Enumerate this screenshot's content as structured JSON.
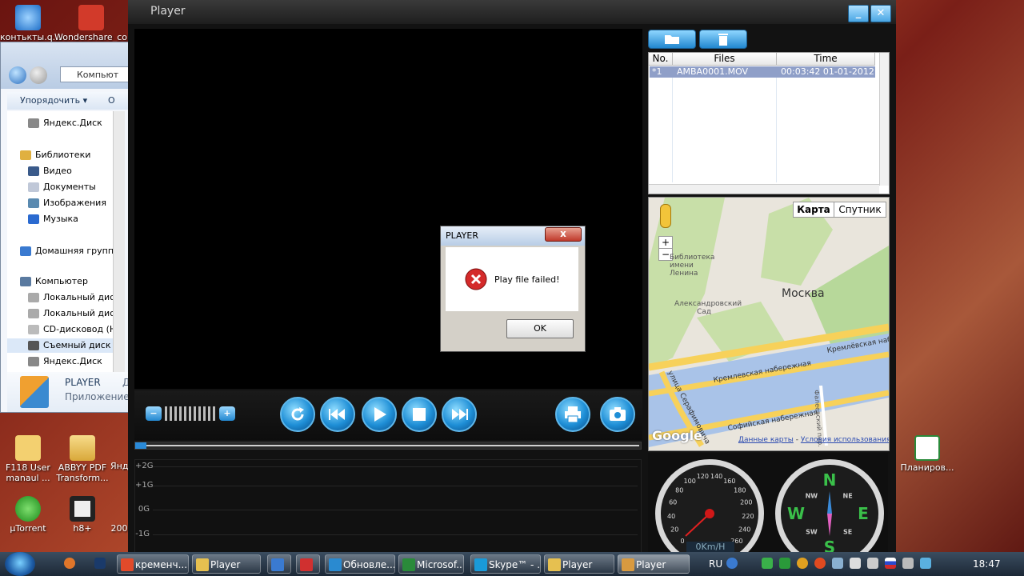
{
  "desktop": {
    "icons_top": [
      {
        "label": "контькты.q...",
        "color": "#3b8bd6"
      },
      {
        "label": "Wondershare_com",
        "color": "#d23a2a"
      }
    ],
    "icons_bottom": [
      {
        "label": "F118 User manaul ...",
        "color": "#f0c060"
      },
      {
        "label": "ABBYY PDF Transform...",
        "color": "#e8c060"
      },
      {
        "label": "Янд",
        "color": "#e8c060"
      },
      {
        "label": "μTorrent",
        "color": "#2aa02a"
      },
      {
        "label": "h8+",
        "color": "#222222"
      },
      {
        "label": "200",
        "color": "#888888"
      },
      {
        "label": "Планиров...",
        "color": "#2a8a3a"
      }
    ]
  },
  "explorer": {
    "address": "Компьют",
    "organize_label": "Упорядочить",
    "cmd2": "О",
    "tree": [
      {
        "label": "Яндекс.Диск",
        "indent": 1,
        "color": "#888"
      },
      {
        "label": "Библиотеки",
        "indent": 0,
        "color": "#e0b040"
      },
      {
        "label": "Видео",
        "indent": 1,
        "color": "#3a5a8a"
      },
      {
        "label": "Документы",
        "indent": 1,
        "color": "#c0c8d8"
      },
      {
        "label": "Изображения",
        "indent": 1,
        "color": "#5a8ab0"
      },
      {
        "label": "Музыка",
        "indent": 1,
        "color": "#2a6ad0"
      },
      {
        "label": "Домашняя группа",
        "indent": 0,
        "color": "#3a7ad0"
      },
      {
        "label": "Компьютер",
        "indent": 0,
        "color": "#5a7aa0"
      },
      {
        "label": "Локальный диск",
        "indent": 1,
        "color": "#aaa"
      },
      {
        "label": "Локальный диск",
        "indent": 1,
        "color": "#aaa"
      },
      {
        "label": "CD-дисковод (H",
        "indent": 1,
        "color": "#bbb"
      },
      {
        "label": "Съемный диск (",
        "indent": 1,
        "color": "#555"
      },
      {
        "label": "Яндекс.Диск",
        "indent": 1,
        "color": "#888"
      }
    ],
    "details_name": "PLAYER",
    "details_type": "Приложение",
    "details_extra": "Д"
  },
  "player": {
    "title": "Player",
    "minimize": "_",
    "close": "✕",
    "playlist_headers": [
      "No.",
      "Files",
      "Time"
    ],
    "playlist_rows": [
      {
        "no": "*1",
        "file": "AMBA0001.MOV",
        "time": "00:03:42 01-01-2012"
      }
    ],
    "graph_labels": [
      "+2G",
      "+1G",
      "0G",
      "-1G"
    ],
    "speed_readout": "0Km/H",
    "speed_ticks": [
      "0",
      "20",
      "40",
      "60",
      "80",
      "100",
      "120",
      "140",
      "160",
      "180",
      "200",
      "220",
      "240",
      "260"
    ],
    "compass_letters": [
      "N",
      "E",
      "S",
      "W",
      "NE",
      "SE",
      "SW",
      "NW"
    ]
  },
  "map": {
    "tab_map": "Карта",
    "tab_satellite": "Спутник",
    "city": "Москва",
    "poi1": "Библиотека имени Ленина",
    "poi2": "Александровский Сад",
    "street1": "Кремлёвская набе",
    "street2": "Кремлевская набережная",
    "street3": "Софийская набережная",
    "street4": "улица Серафимовича",
    "street5": "Фалеевский пер.",
    "zoom_in": "+",
    "zoom_out": "−",
    "logo": "Google",
    "footer_data": "Данные карты",
    "footer_sep": " - ",
    "footer_terms": "Условия использования"
  },
  "dialog": {
    "title": "PLAYER",
    "close": "x",
    "message": "Play file failed!",
    "ok": "OK"
  },
  "taskbar": {
    "buttons": [
      {
        "label": "кременч...",
        "color": "#e24a2a"
      },
      {
        "label": "Player",
        "color": "#e6c050"
      },
      {
        "label": "",
        "color": "#3a7ad0"
      },
      {
        "label": "",
        "color": "#d03030"
      },
      {
        "label": "Обновле...",
        "color": "#2a8ad0"
      },
      {
        "label": "Microsof...",
        "color": "#2a8a3a"
      },
      {
        "label": "Skype™ - ...",
        "color": "#1a9ad8"
      },
      {
        "label": "Player",
        "color": "#e6c050"
      },
      {
        "label": "Player",
        "color": "#d89a40"
      }
    ],
    "lang": "RU",
    "clock": "18:47"
  }
}
